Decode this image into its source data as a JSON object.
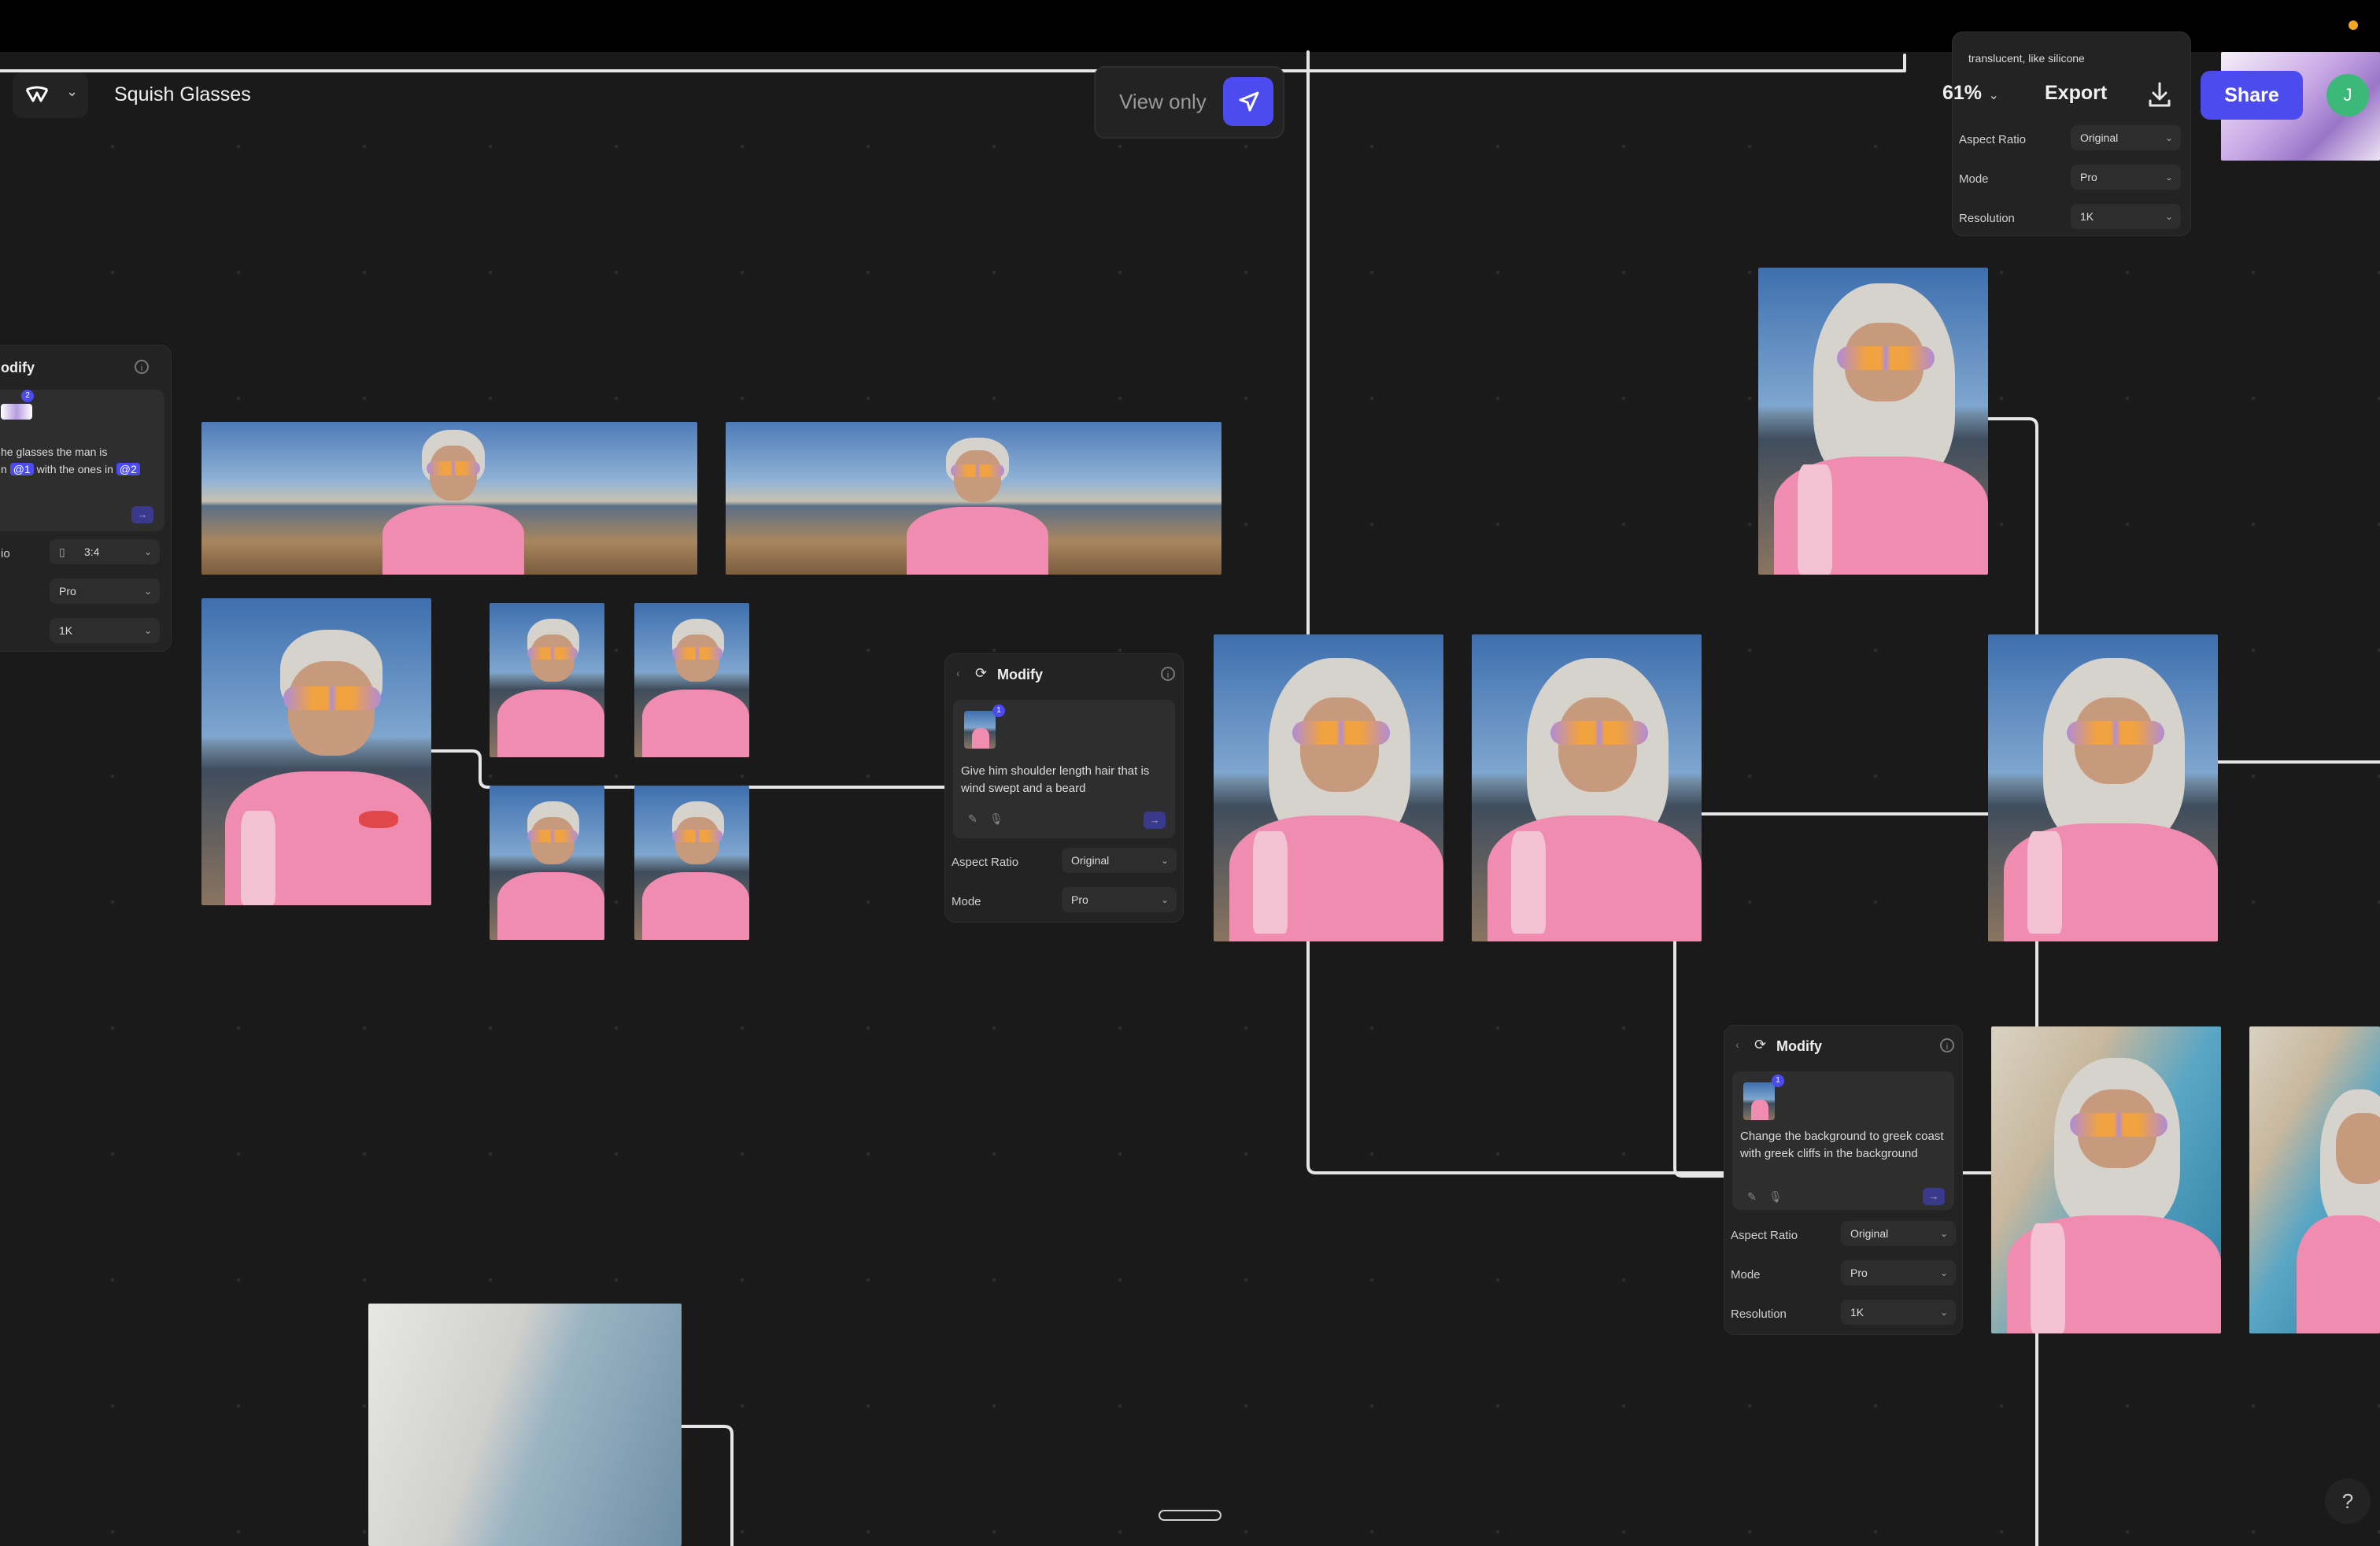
{
  "header": {
    "project_title": "Squish Glasses",
    "view_mode_label": "View only",
    "zoom_label": "61%",
    "export_label": "Export",
    "share_label": "Share",
    "avatar_initial": "J",
    "help_label": "?"
  },
  "top_right_panel": {
    "prompt_snippet": "translucent, like silicone",
    "settings": [
      {
        "label": "Aspect Ratio",
        "value": "Original"
      },
      {
        "label": "Mode",
        "value": "Pro"
      },
      {
        "label": "Resolution",
        "value": "1K"
      }
    ]
  },
  "left_panel": {
    "title": "odify",
    "ref_badge": "2",
    "prompt_line1": "he glasses the man is",
    "prompt_line2_pre": "n",
    "prompt_tag1": "@1",
    "prompt_line2_mid": "with the ones in",
    "prompt_tag2": "@2",
    "settings": [
      {
        "label": "io",
        "value": "3:4"
      },
      {
        "label": "",
        "value": "Pro"
      },
      {
        "label": "",
        "value": "1K"
      }
    ]
  },
  "center_panel": {
    "title": "Modify",
    "ref_badge": "1",
    "prompt": "Give him shoulder length hair that is wind swept and a beard",
    "settings": [
      {
        "label": "Aspect Ratio",
        "value": "Original"
      },
      {
        "label": "Mode",
        "value": "Pro"
      }
    ]
  },
  "right_panel": {
    "title": "Modify",
    "ref_badge": "1",
    "prompt": "Change the background to greek coast with greek cliffs in the background",
    "settings": [
      {
        "label": "Aspect Ratio",
        "value": "Original"
      },
      {
        "label": "Mode",
        "value": "Pro"
      },
      {
        "label": "Resolution",
        "value": "1K"
      }
    ]
  },
  "icons": {
    "send": "arrow-right-icon",
    "brush": "brush-icon",
    "mic": "mic-icon",
    "info": "info-icon",
    "modify": "modify-icon",
    "cursor": "cursor-icon",
    "download": "download-icon"
  },
  "colors": {
    "accent": "#4b4bf0",
    "canvas": "#1a1a1a",
    "avatar": "#3cb878",
    "notification": "#f5a623"
  }
}
